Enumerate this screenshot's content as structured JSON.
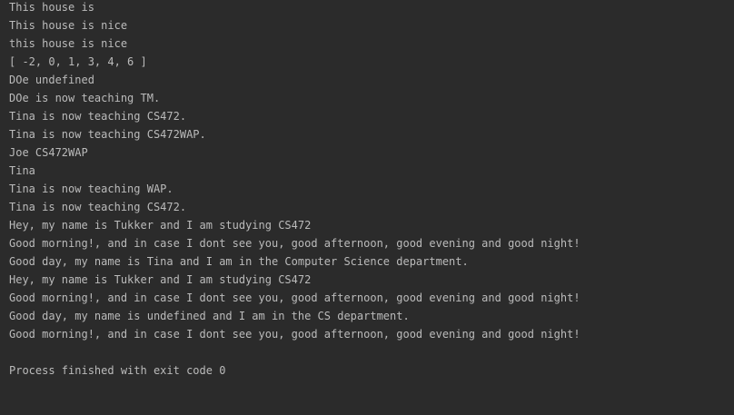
{
  "console": {
    "lines": [
      "This house is",
      "This house is nice",
      "this house is nice",
      "[ -2, 0, 1, 3, 4, 6 ]",
      "DOe undefined",
      "DOe is now teaching TM.",
      "Tina is now teaching CS472.",
      "Tina is now teaching CS472WAP.",
      "Joe CS472WAP",
      "Tina",
      "Tina is now teaching WAP.",
      "Tina is now teaching CS472.",
      "Hey, my name is Tukker and I am studying CS472",
      "Good morning!, and in case I dont see you, good afternoon, good evening and good night!",
      "Good day, my name is Tina and I am in the Computer Science department.",
      "Hey, my name is Tukker and I am studying CS472",
      "Good morning!, and in case I dont see you, good afternoon, good evening and good night!",
      "Good day, my name is undefined and I am in the CS department.",
      "Good morning!, and in case I dont see you, good afternoon, good evening and good night!",
      "",
      "Process finished with exit code 0"
    ]
  },
  "colors": {
    "background": "#2b2b2b",
    "text": "#bbbbbb"
  }
}
